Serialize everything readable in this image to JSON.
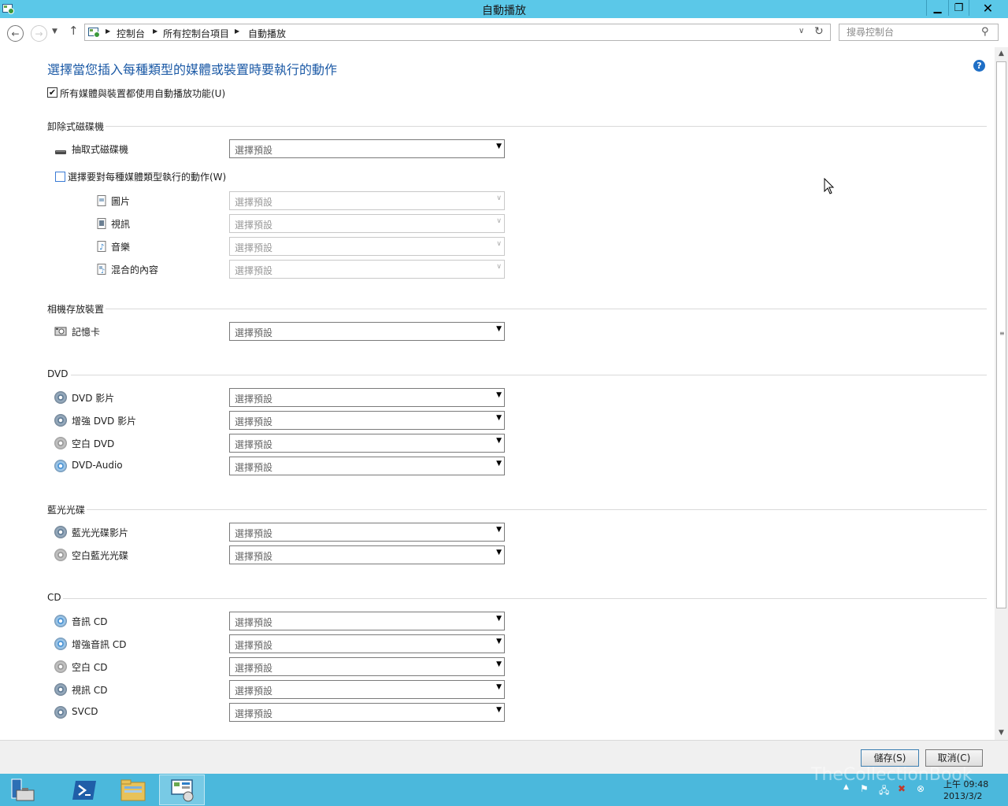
{
  "window": {
    "title": "自動播放"
  },
  "address": {
    "crumbs": [
      "控制台",
      "所有控制台項目",
      "自動播放"
    ],
    "search_placeholder": "搜尋控制台"
  },
  "page": {
    "title": "選擇當您插入每種類型的媒體或裝置時要執行的動作",
    "use_autoplay_label": "所有媒體與裝置都使用自動播放功能(U)",
    "use_autoplay_checked": true
  },
  "sections": {
    "removable": {
      "title": "卸除式磁碟機",
      "drive_label": "抽取式磁碟機",
      "per_type_label": "選擇要對每種媒體類型執行的動作(W)",
      "per_type_checked": false,
      "types": [
        "圖片",
        "視訊",
        "音樂",
        "混合的內容"
      ]
    },
    "camera": {
      "title": "相機存放裝置",
      "items": [
        "記憶卡"
      ]
    },
    "dvd": {
      "title": "DVD",
      "items": [
        "DVD 影片",
        "增強 DVD 影片",
        "空白 DVD",
        "DVD-Audio"
      ]
    },
    "bluray": {
      "title": "藍光光碟",
      "items": [
        "藍光光碟影片",
        "空白藍光光碟"
      ]
    },
    "cd": {
      "title": "CD",
      "items": [
        "音訊 CD",
        "增強音訊 CD",
        "空白 CD",
        "視訊 CD",
        "SVCD"
      ]
    }
  },
  "select_default": "選擇預設",
  "footer": {
    "save_label": "儲存(S)",
    "cancel_label": "取消(C)"
  },
  "taskbar": {
    "time": "上午 09:48",
    "date": "2013/3/2"
  },
  "watermark": "TheCollectionBook",
  "colors": {
    "title_bar": "#5bc8e8",
    "taskbar": "#4bb8dc",
    "heading": "#1c5aa6"
  }
}
